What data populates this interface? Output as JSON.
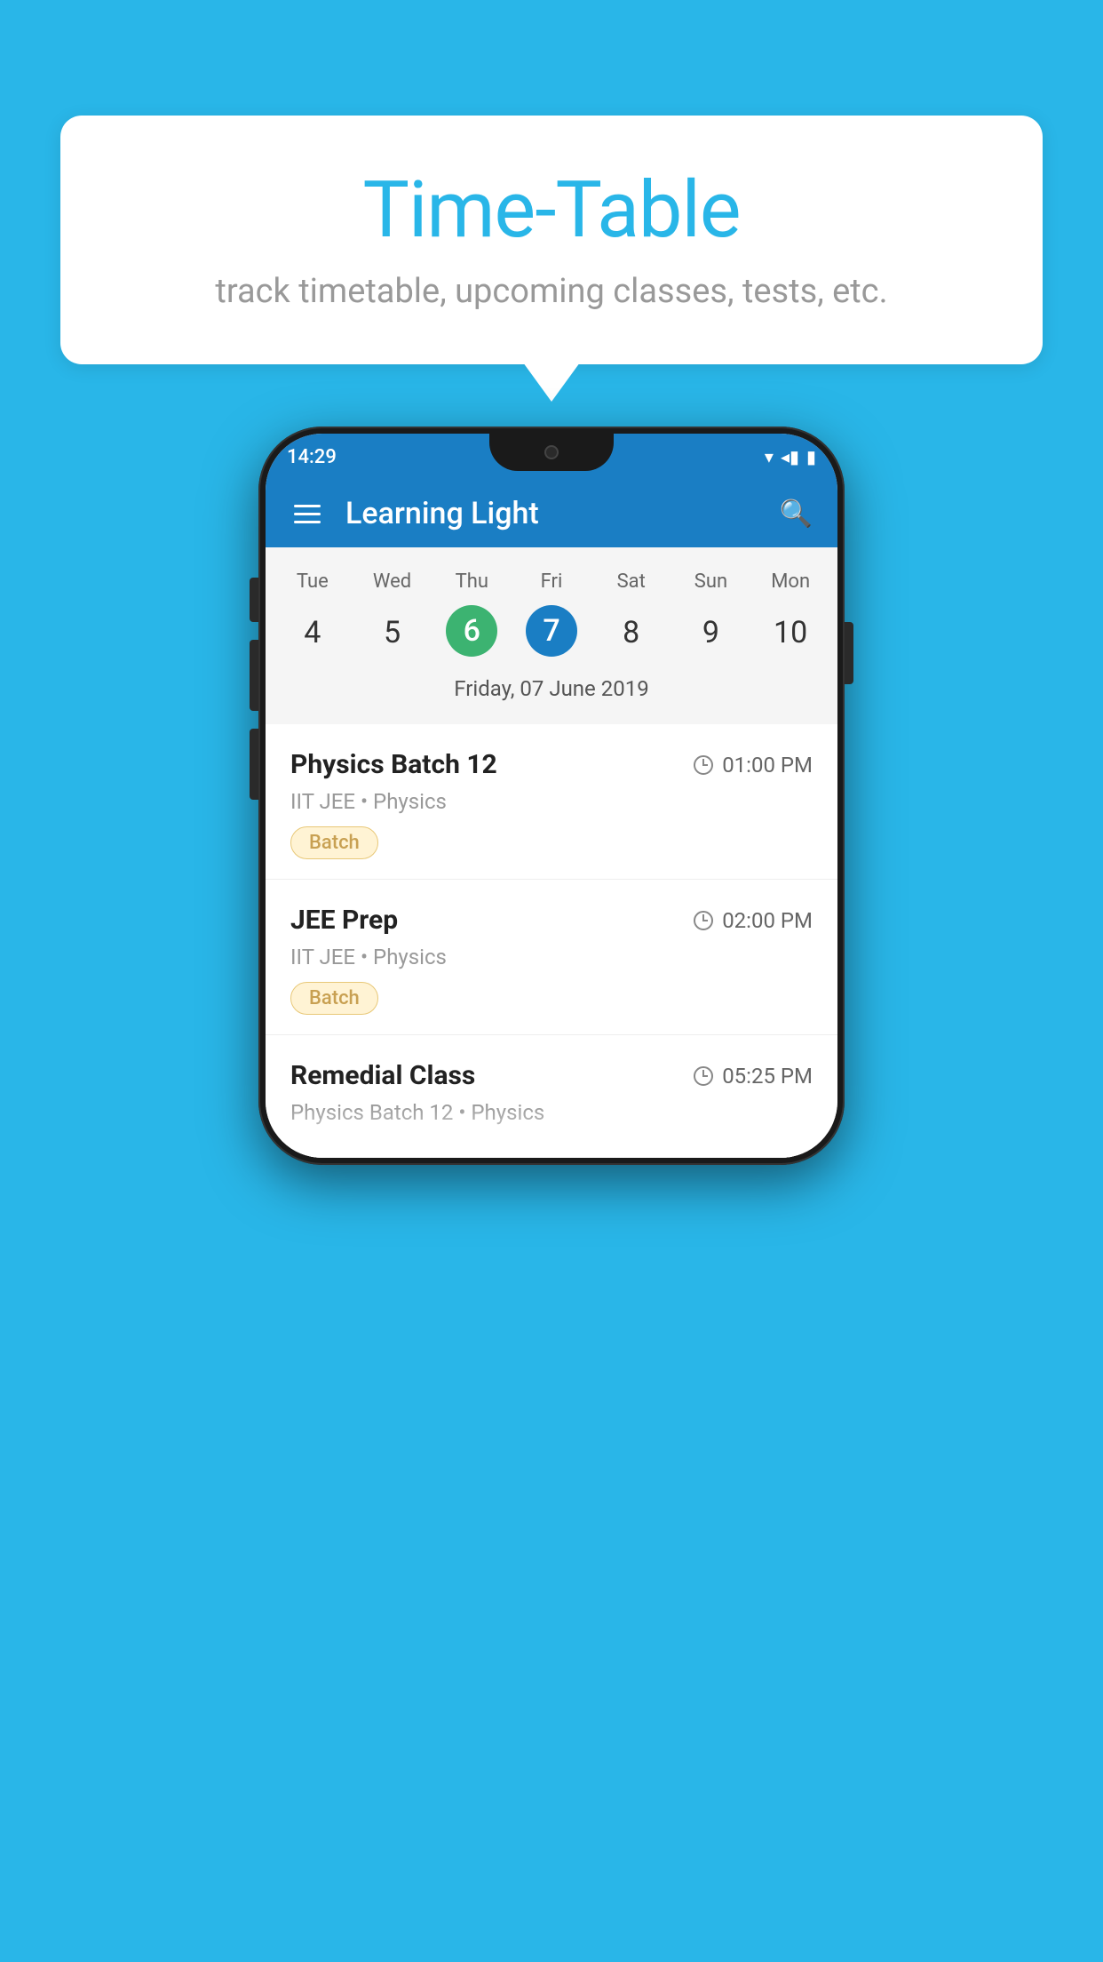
{
  "background_color": "#29b6e8",
  "speech_bubble": {
    "title": "Time-Table",
    "subtitle": "track timetable, upcoming classes, tests, etc."
  },
  "phone": {
    "status_bar": {
      "time": "14:29",
      "icons": "▼◂▮"
    },
    "top_bar": {
      "app_name": "Learning Light"
    },
    "calendar": {
      "days": [
        "Tue",
        "Wed",
        "Thu",
        "Fri",
        "Sat",
        "Sun",
        "Mon"
      ],
      "dates": [
        "4",
        "5",
        "6",
        "7",
        "8",
        "9",
        "10"
      ],
      "today_index": 2,
      "selected_index": 3,
      "selected_label": "Friday, 07 June 2019"
    },
    "schedule": [
      {
        "title": "Physics Batch 12",
        "time": "01:00 PM",
        "subtitle": "IIT JEE • Physics",
        "badge": "Batch"
      },
      {
        "title": "JEE Prep",
        "time": "02:00 PM",
        "subtitle": "IIT JEE • Physics",
        "badge": "Batch"
      },
      {
        "title": "Remedial Class",
        "time": "05:25 PM",
        "subtitle": "Physics Batch 12 • Physics",
        "badge": ""
      }
    ]
  }
}
